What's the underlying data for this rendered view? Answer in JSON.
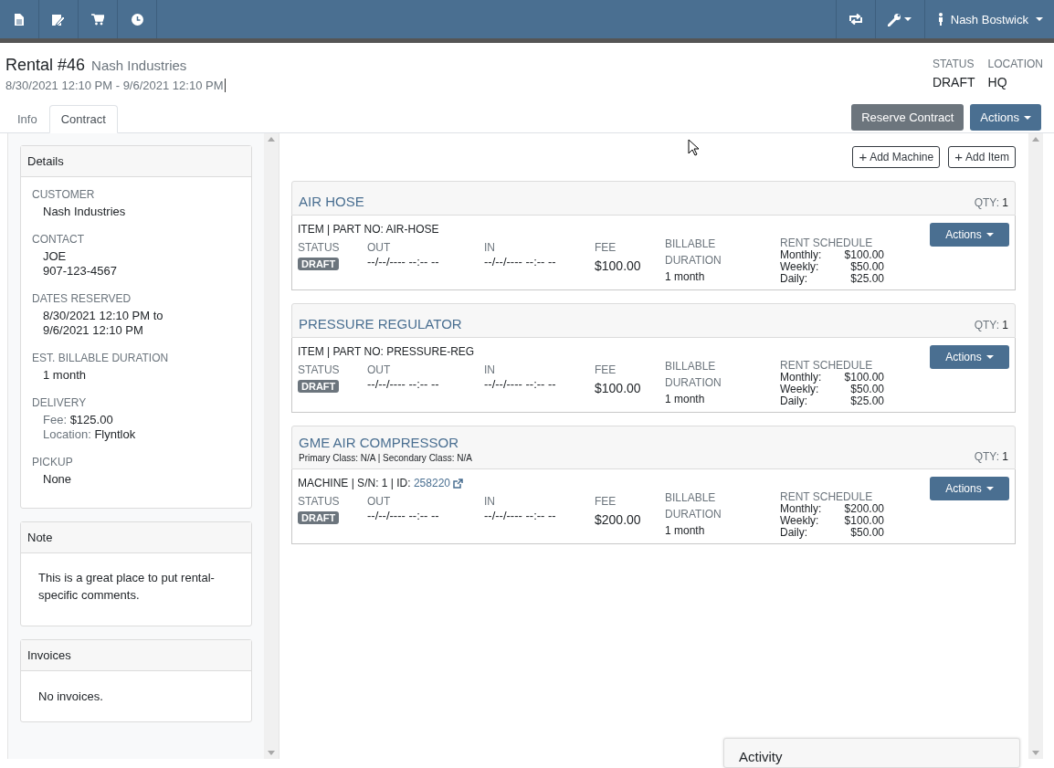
{
  "navbar": {
    "user": "Nash Bostwick"
  },
  "header": {
    "title": "Rental #46",
    "customer": "Nash Industries",
    "dates": "8/30/2021 12:10 PM - 9/6/2021 12:10 PM",
    "meta": [
      {
        "label": "STATUS",
        "value": "DRAFT"
      },
      {
        "label": "LOCATION",
        "value": "HQ"
      }
    ]
  },
  "tabs": [
    {
      "label": "Info",
      "selected": false
    },
    {
      "label": "Contract",
      "selected": true
    }
  ],
  "buttons": {
    "reserve": "Reserve Contract",
    "actions": "Actions"
  },
  "details": {
    "title": "Details",
    "fields": [
      {
        "label": "CUSTOMER",
        "lines": [
          "Nash Industries"
        ]
      },
      {
        "label": "CONTACT",
        "lines": [
          "JOE",
          "907-123-4567"
        ]
      },
      {
        "label": "DATES RESERVED",
        "lines": [
          "8/30/2021 12:10 PM to",
          "9/6/2021 12:10 PM"
        ]
      },
      {
        "label": "EST. BILLABLE DURATION",
        "lines": [
          "1 month"
        ]
      },
      {
        "label": "DELIVERY",
        "pairs": [
          {
            "key": "Fee:",
            "value": "$125.00"
          },
          {
            "key": "Location:",
            "value": "Flyntlok"
          }
        ]
      },
      {
        "label": "PICKUP",
        "lines": [
          "None"
        ]
      }
    ]
  },
  "note": {
    "title": "Note",
    "text": "This is a great place to put rental-specific comments."
  },
  "invoices": {
    "title": "Invoices",
    "text": "No invoices."
  },
  "toolbar": [
    {
      "icon": "+",
      "label": "Add Machine"
    },
    {
      "icon": "+",
      "label": "Add Item"
    }
  ],
  "lines": [
    {
      "name": "AIR HOSE",
      "qty_label": "QTY:",
      "qty": "1",
      "ident": "ITEM | PART NO: AIR-HOSE",
      "status_label": "STATUS",
      "status": "DRAFT",
      "out_label": "OUT",
      "out": "--/--/---- --:-- --",
      "in_label": "IN",
      "in": "--/--/---- --:-- --",
      "fee_label": "FEE",
      "fee": "$100.00",
      "billable_label": "BILLABLE DURATION",
      "billable": "1 month",
      "schedule_label": "RENT SCHEDULE",
      "schedule": [
        {
          "period": "Monthly:",
          "price": "$100.00"
        },
        {
          "period": "Weekly:",
          "price": "$50.00"
        },
        {
          "period": "Daily:",
          "price": "$25.00"
        }
      ],
      "actions": "Actions"
    },
    {
      "name": "PRESSURE REGULATOR",
      "qty_label": "QTY:",
      "qty": "1",
      "ident": "ITEM | PART NO: PRESSURE-REG",
      "status_label": "STATUS",
      "status": "DRAFT",
      "out_label": "OUT",
      "out": "--/--/---- --:-- --",
      "in_label": "IN",
      "in": "--/--/---- --:-- --",
      "fee_label": "FEE",
      "fee": "$100.00",
      "billable_label": "BILLABLE DURATION",
      "billable": "1 month",
      "schedule_label": "RENT SCHEDULE",
      "schedule": [
        {
          "period": "Monthly:",
          "price": "$100.00"
        },
        {
          "period": "Weekly:",
          "price": "$50.00"
        },
        {
          "period": "Daily:",
          "price": "$25.00"
        }
      ],
      "actions": "Actions"
    },
    {
      "name": "GME AIR COMPRESSOR",
      "subtitle": "Primary Class: N/A | Secondary Class: N/A",
      "qty_label": "QTY:",
      "qty": "1",
      "ident": "MACHINE | S/N: 1 | ID:",
      "ident_link": "258220",
      "status_label": "STATUS",
      "status": "DRAFT",
      "out_label": "OUT",
      "out": "--/--/---- --:-- --",
      "in_label": "IN",
      "in": "--/--/---- --:-- --",
      "fee_label": "FEE",
      "fee": "$200.00",
      "billable_label": "BILLABLE DURATION",
      "billable": "1 month",
      "schedule_label": "RENT SCHEDULE",
      "schedule": [
        {
          "period": "Monthly:",
          "price": "$200.00"
        },
        {
          "period": "Weekly:",
          "price": "$100.00"
        },
        {
          "period": "Daily:",
          "price": "$50.00"
        }
      ],
      "actions": "Actions"
    }
  ],
  "activity": {
    "title": "Activity"
  }
}
